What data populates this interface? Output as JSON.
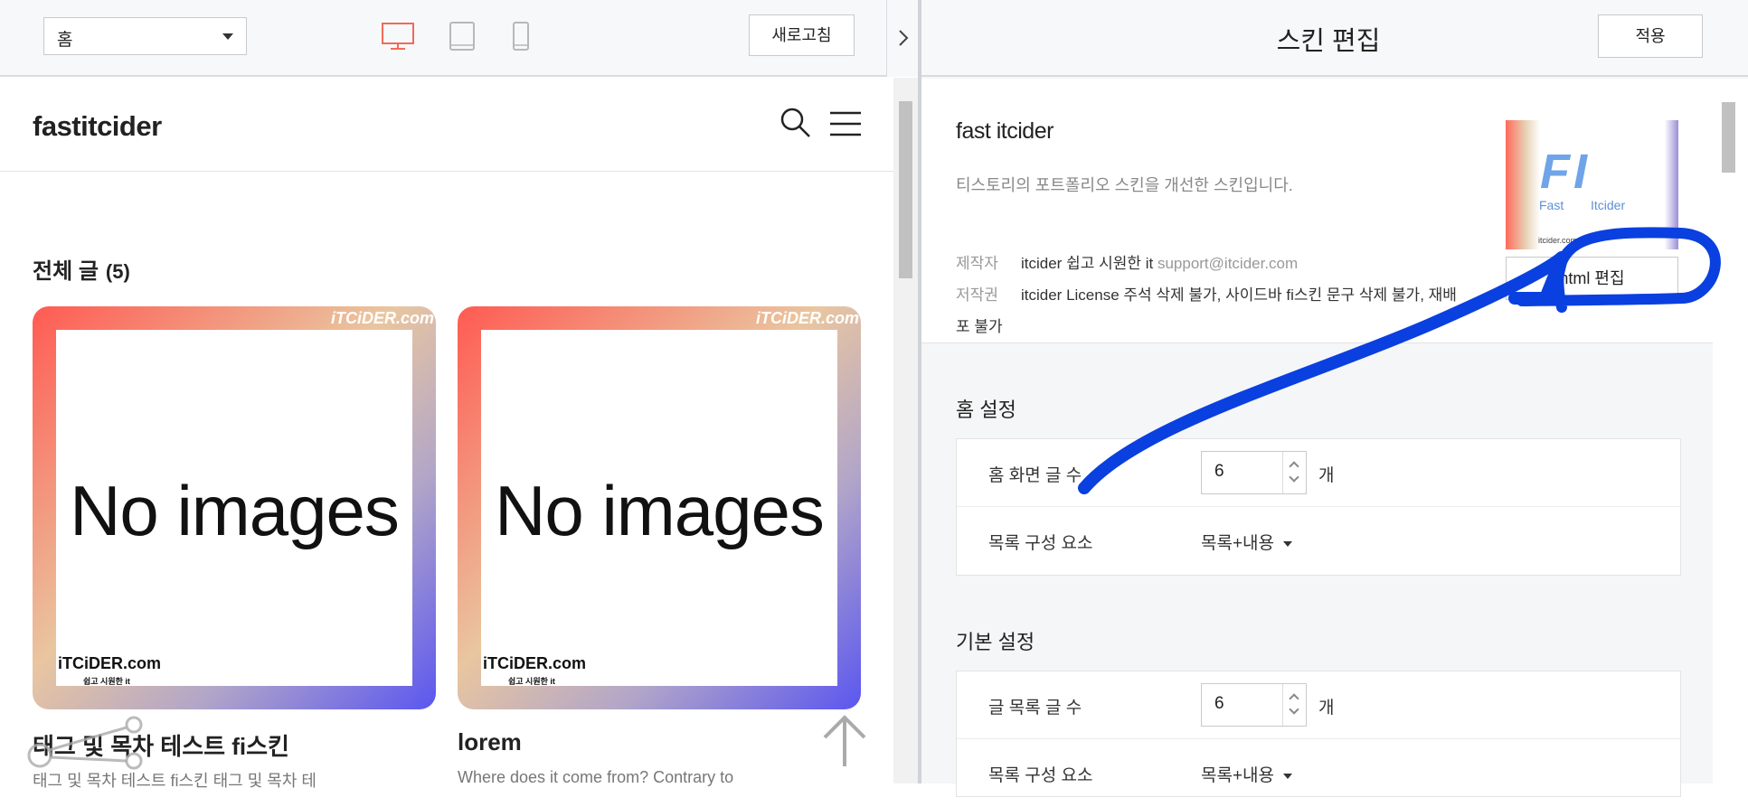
{
  "toolbar": {
    "page_select_value": "홈",
    "refresh_label": "새로고침",
    "device_buttons": [
      "desktop-icon",
      "tablet-icon",
      "mobile-icon"
    ],
    "active_device": "desktop"
  },
  "preview": {
    "blog_title": "fastitcider",
    "all_posts_label": "전체 글",
    "all_posts_count": "(5)",
    "posts": [
      {
        "thumb_text": "No images",
        "watermark_top": "iTCiDER.com",
        "watermark_bottom": "iTCiDER.com",
        "watermark_sub": "쉽고 시원한 it",
        "title": "태그 및 목차 테스트 fi스킨",
        "excerpt": "태그 및 목차 테스트 fi스킨 태그 및 목차 테"
      },
      {
        "thumb_text": "No images",
        "watermark_top": "iTCiDER.com",
        "watermark_bottom": "iTCiDER.com",
        "watermark_sub": "쉽고 시원한 it",
        "title": "lorem",
        "excerpt": "Where does it come from? Contrary to"
      }
    ]
  },
  "editor": {
    "title": "스킨 편집",
    "apply_label": "적용",
    "skin": {
      "name": "fast itcider",
      "description": "티스토리의 포트폴리오 스킨을 개선한 스킨입니다.",
      "maker_key": "제작자",
      "maker_value": "itcider 쉽고 시원한 it",
      "maker_email": "support@itcider.com",
      "copyright_key": "저작권",
      "copyright_value": "itcider License 주석 삭제 불가, 사이드바 fi스킨 문구 삭제 불가, 재배",
      "copyright_value_2": "포 불가",
      "thumb_logo": "FI",
      "thumb_fast": "Fast",
      "thumb_itcider": "Itcider",
      "thumb_small": "itcider.com",
      "html_edit_label": "html 편집"
    },
    "home_settings": {
      "title": "홈 설정",
      "rows": [
        {
          "label": "홈 화면 글 수",
          "value": "6",
          "unit": "개"
        },
        {
          "label": "목록 구성 요소",
          "value": "목록+내용"
        }
      ]
    },
    "basic_settings": {
      "title": "기본 설정",
      "rows": [
        {
          "label": "글 목록 글 수",
          "value": "6",
          "unit": "개"
        },
        {
          "label": "목록 구성 요소",
          "value": "목록+내용"
        }
      ]
    }
  },
  "colors": {
    "accent_active_device": "#f06a5a",
    "annotation_stroke": "#0a3fe0",
    "card_gradient": [
      "#ff5a52",
      "#e9c6a0",
      "#b2a6c8",
      "#5a56f0"
    ]
  }
}
